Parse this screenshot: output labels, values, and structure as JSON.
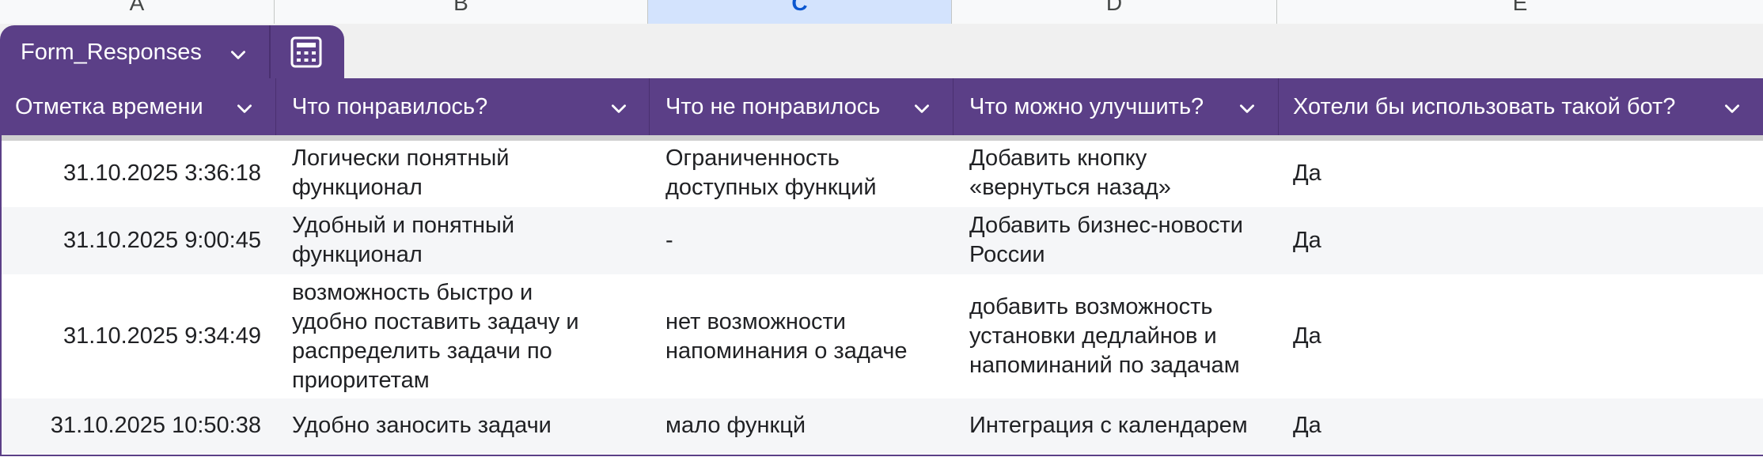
{
  "column_letters": [
    "A",
    "B",
    "C",
    "D",
    "E"
  ],
  "selected_column": "C",
  "sheet_tab": {
    "name": "Form_Responses",
    "chevron_icon": "chevron-down-icon",
    "extra_icon": "calculator-icon"
  },
  "colors": {
    "header_bg": "#5b3f87",
    "header_text": "#ffffff",
    "alt_row": "#f5f6f8",
    "selected_column": "#d3e3fd"
  },
  "table": {
    "headers": [
      "Отметка времени",
      "Что понравилось?",
      "Что не понравилось",
      "Что можно улучшить?",
      "Хотели бы использовать такой бот?"
    ],
    "rows": [
      {
        "timestamp": "31.10.2025 3:36:18",
        "liked": [
          "Логически понятный",
          "функционал"
        ],
        "disliked": [
          "Ограниченность",
          "доступных функций"
        ],
        "improve": [
          "Добавить кнопку",
          "«вернуться назад»"
        ],
        "would_use": "Да"
      },
      {
        "timestamp": "31.10.2025 9:00:45",
        "liked": [
          "Удобный и понятный",
          "функционал"
        ],
        "disliked": [
          "-"
        ],
        "improve": [
          "Добавить бизнес-новости",
          "России"
        ],
        "would_use": "Да"
      },
      {
        "timestamp": "31.10.2025 9:34:49",
        "liked": [
          "возможность быстро и",
          "удобно поставить задачу и",
          "распределить задачи по",
          "приоритетам"
        ],
        "disliked": [
          "нет возможности",
          "напоминания о задаче"
        ],
        "improve": [
          "добавить возможность",
          "установки дедлайнов и",
          "напоминаний по задачам"
        ],
        "would_use": "Да"
      },
      {
        "timestamp": "31.10.2025 10:50:38",
        "liked": [
          "Удобно заносить задачи"
        ],
        "disliked": [
          "мало функцй"
        ],
        "improve": [
          "Интеграция с календарем"
        ],
        "would_use": "Да"
      }
    ]
  }
}
